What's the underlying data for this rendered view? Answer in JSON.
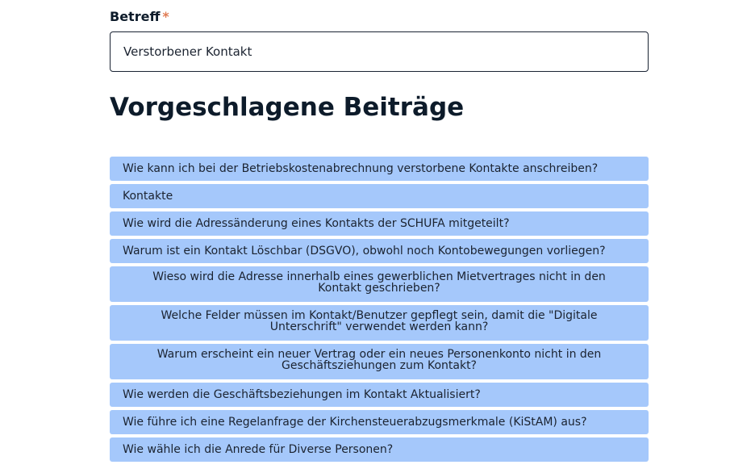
{
  "form": {
    "subject_label": "Betreff",
    "required_marker": "*",
    "subject_value": "Verstorbener Kontakt"
  },
  "suggestions": {
    "title": "Vorgeschlagene Beiträge",
    "items": [
      {
        "label": "Wie kann ich bei der Betriebskostenabrechnung verstorbene Kontakte anschreiben?"
      },
      {
        "label": "Kontakte"
      },
      {
        "label": "Wie wird die Adressänderung eines Kontakts der SCHUFA mitgeteilt?"
      },
      {
        "label": "Warum ist ein Kontakt Löschbar (DSGVO), obwohl noch Kontobewegungen vorliegen?"
      },
      {
        "label": "Wieso wird die Adresse innerhalb eines gewerblichen Mietvertrages nicht in den Kontakt geschrieben?"
      },
      {
        "label": "Welche Felder müssen im Kontakt/Benutzer gepflegt sein, damit die \"Digitale Unterschrift\" verwendet werden kann?"
      },
      {
        "label": "Warum erscheint ein neuer Vertrag oder ein neues Personenkonto nicht in den Geschäftsziehungen zum Kontakt?"
      },
      {
        "label": "Wie werden die Geschäftsbeziehungen im Kontakt Aktualisiert?"
      },
      {
        "label": "Wie führe ich eine Regelanfrage der Kirchensteuerabzugsmerkmale (KiStAM) aus?"
      },
      {
        "label": "Wie wähle ich die Anrede für Diverse Personen?"
      }
    ]
  },
  "colors": {
    "accent": "#a5c8fb",
    "required": "#e07b53",
    "text": "#0d1b2a"
  }
}
